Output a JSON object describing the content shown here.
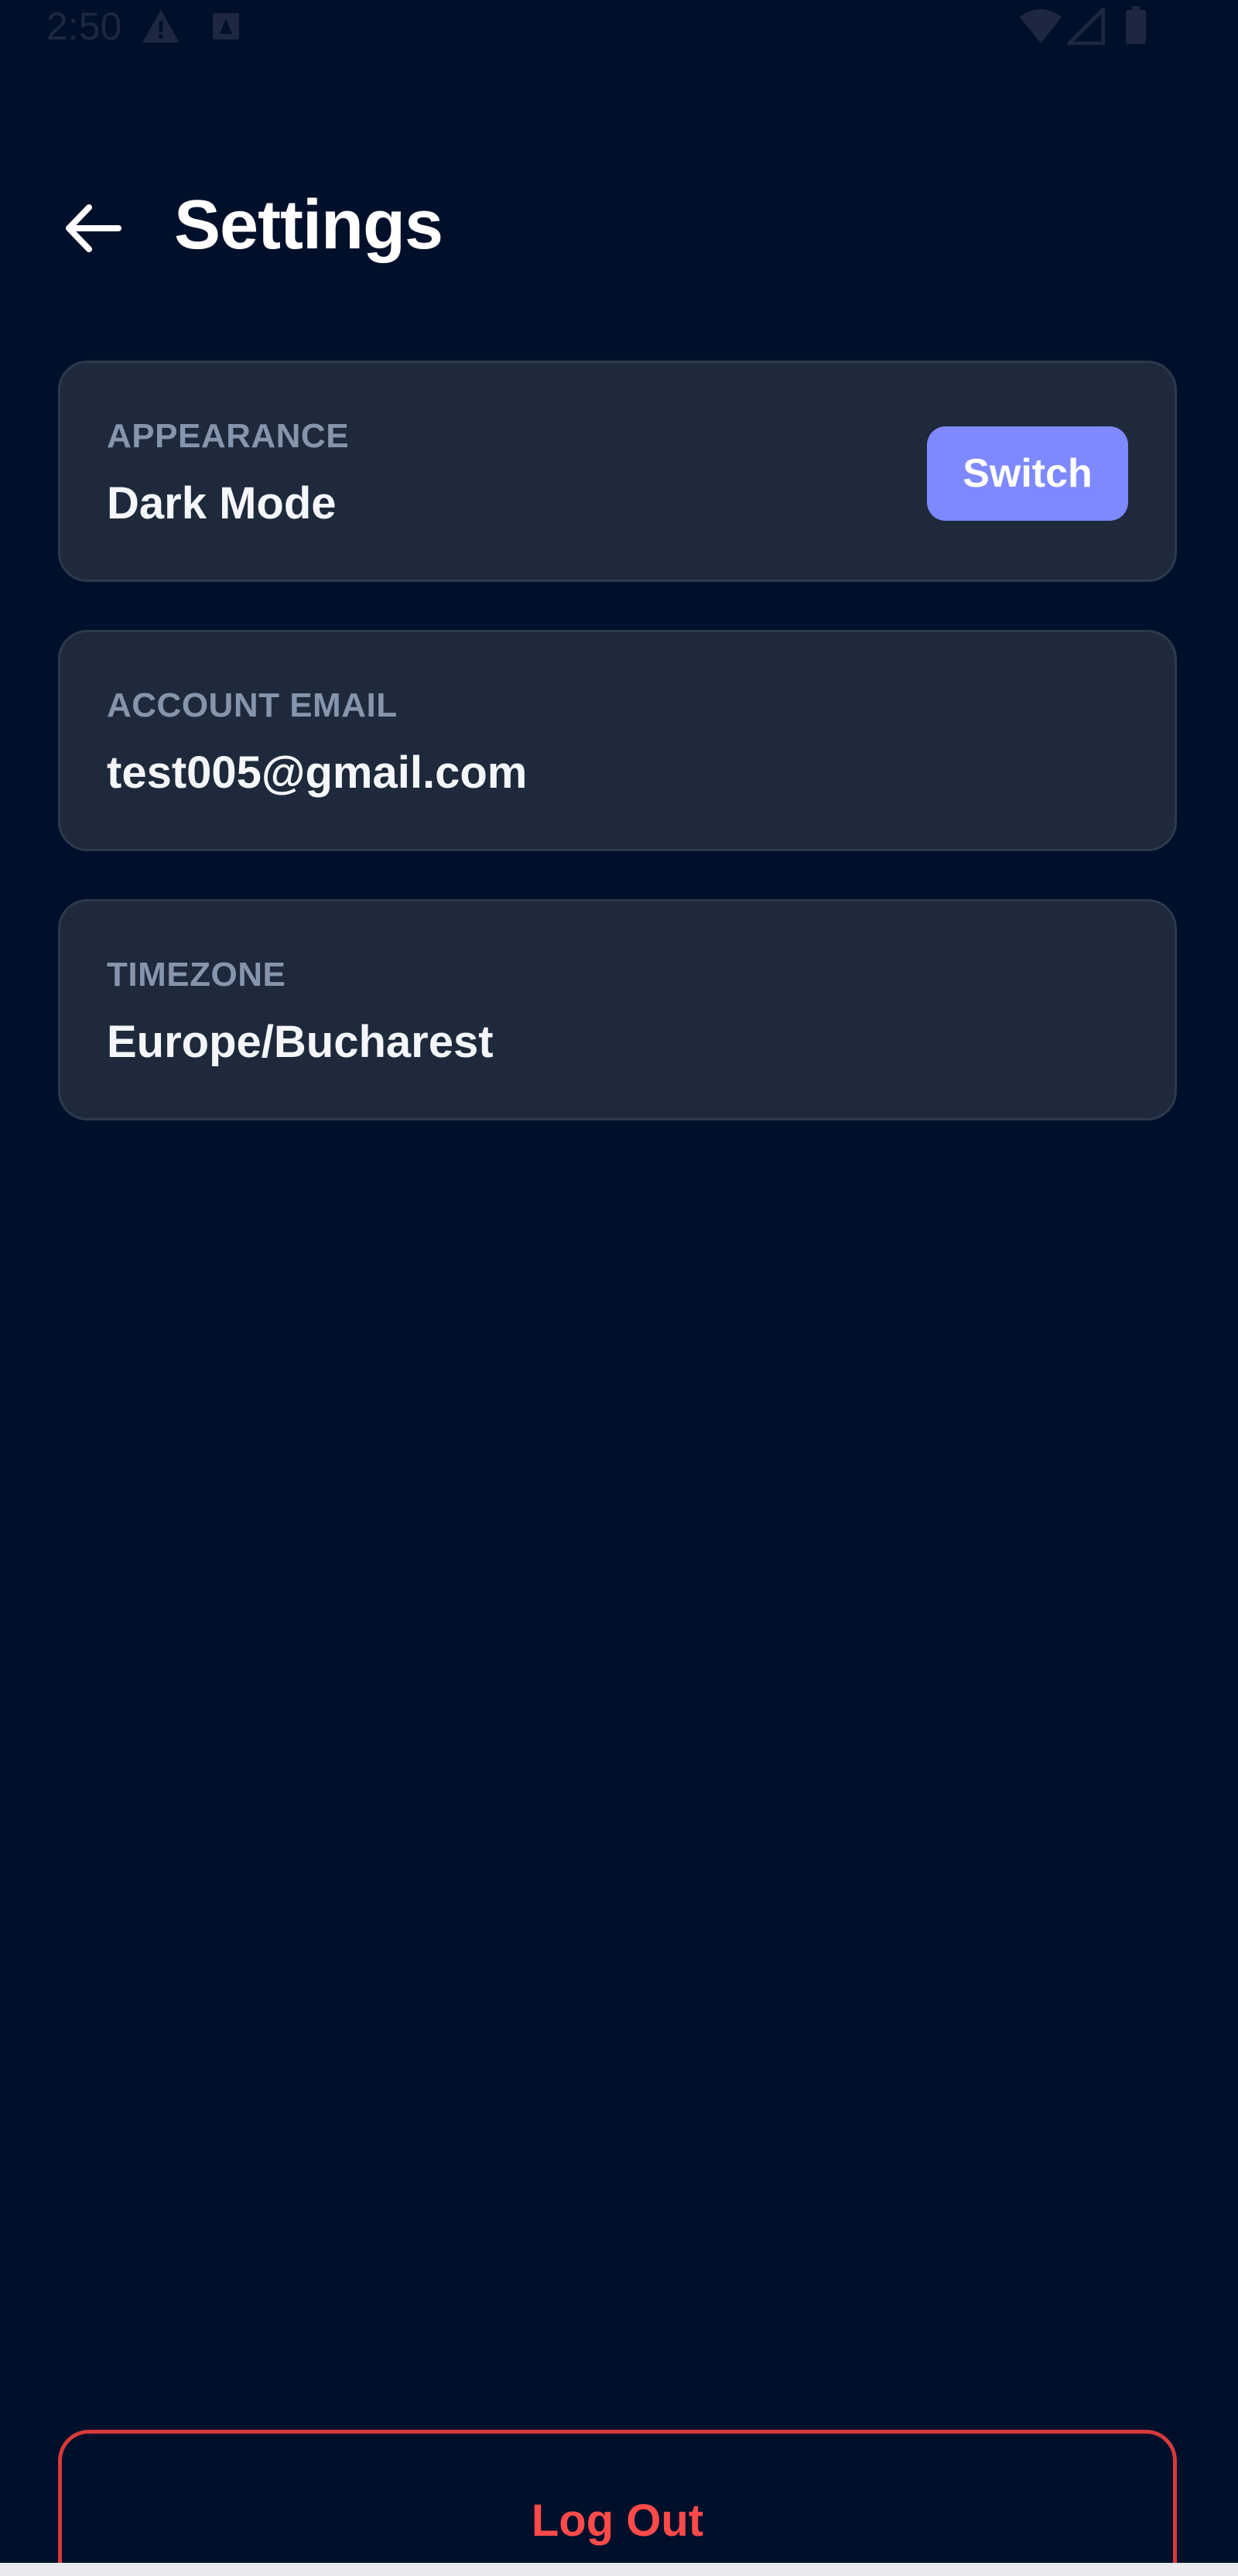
{
  "status_bar": {
    "time": "2:50",
    "icons": [
      "warning-icon",
      "notification-icon",
      "wifi-icon",
      "cellular-signal-icon",
      "battery-icon"
    ]
  },
  "header": {
    "title": "Settings",
    "back_icon": "arrow-left-icon"
  },
  "settings": {
    "appearance": {
      "label": "APPEARANCE",
      "value": "Dark Mode",
      "button_label": "Switch"
    },
    "account_email": {
      "label": "ACCOUNT EMAIL",
      "value": "test005@gmail.com"
    },
    "timezone": {
      "label": "TIMEZONE",
      "value": "Europe/Bucharest"
    }
  },
  "logout": {
    "label": "Log Out"
  },
  "colors": {
    "background": "#00102a",
    "card": "#1e2a3b",
    "accent": "#7e89ff",
    "danger": "#ff4a4a",
    "label": "#8595ab"
  }
}
